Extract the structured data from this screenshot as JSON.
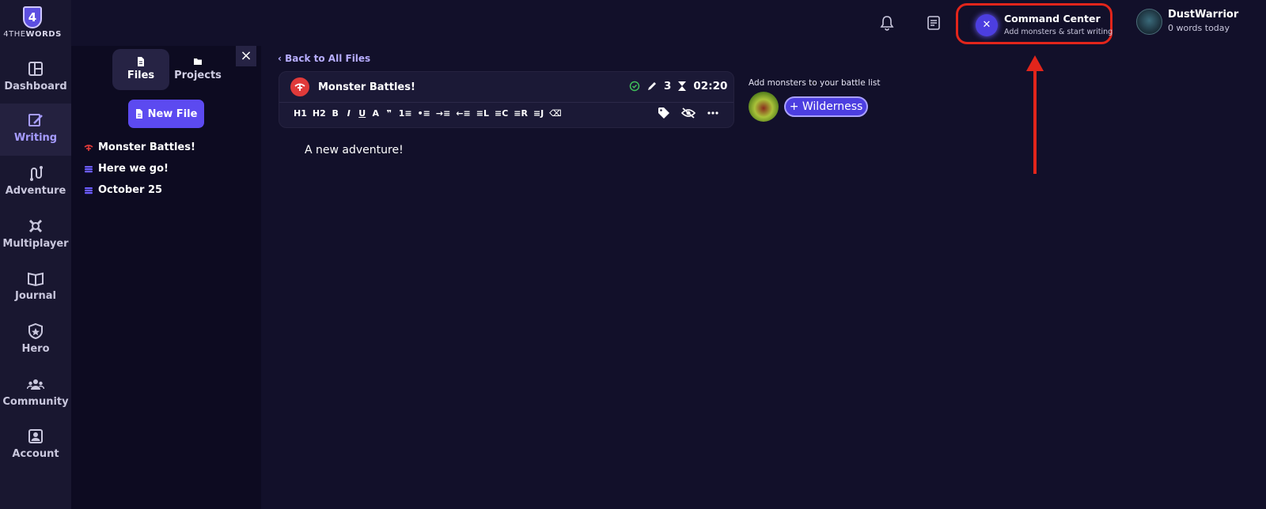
{
  "app": {
    "logo_number": "4",
    "logo_text_light": "4THE",
    "logo_text_bold": "WORDS"
  },
  "nav": {
    "items": [
      {
        "label": "Dashboard",
        "icon": "dashboard-icon"
      },
      {
        "label": "Writing",
        "icon": "writing-icon",
        "active": true
      },
      {
        "label": "Adventure",
        "icon": "adventure-icon"
      },
      {
        "label": "Multiplayer",
        "icon": "multiplayer-icon"
      },
      {
        "label": "Journal",
        "icon": "journal-icon"
      },
      {
        "label": "Hero",
        "icon": "hero-icon"
      },
      {
        "label": "Community",
        "icon": "community-icon"
      },
      {
        "label": "Account",
        "icon": "account-icon"
      }
    ]
  },
  "files_panel": {
    "tabs": [
      {
        "label": "Files",
        "icon": "file-icon",
        "active": true
      },
      {
        "label": "Projects",
        "icon": "folder-icon"
      }
    ],
    "new_file_label": "New File",
    "files": [
      {
        "name": "Monster Battles!",
        "icon": "battle-icon"
      },
      {
        "name": "Here we go!",
        "icon": "stack-icon"
      },
      {
        "name": "October 25",
        "icon": "stack-icon"
      }
    ],
    "close_label": "×"
  },
  "topbar": {
    "command_center": {
      "title": "Command Center",
      "subtitle": "Add monsters & start writing",
      "icon": "swords-icon"
    },
    "user": {
      "name": "DustWarrior",
      "words_today": "0 words today"
    }
  },
  "editor": {
    "back_label": "Back to All Files",
    "file_title": "Monster Battles!",
    "edit_count": "3",
    "timer": "02:20",
    "toolbar": [
      "H1",
      "H2",
      "B",
      "I",
      "U",
      "A",
      "❞",
      "1≡",
      "•≡",
      "→≡",
      "←≡",
      "≡L",
      "≡C",
      "≡R",
      "≡J",
      "⌫"
    ],
    "content": "A new adventure!"
  },
  "battle": {
    "label": "Add monsters to your battle list",
    "wilderness_label": "+ Wilderness"
  },
  "colors": {
    "accent": "#5c4af0",
    "highlight": "#e2251b",
    "background": "#12102a",
    "nav_bg": "#191730"
  }
}
